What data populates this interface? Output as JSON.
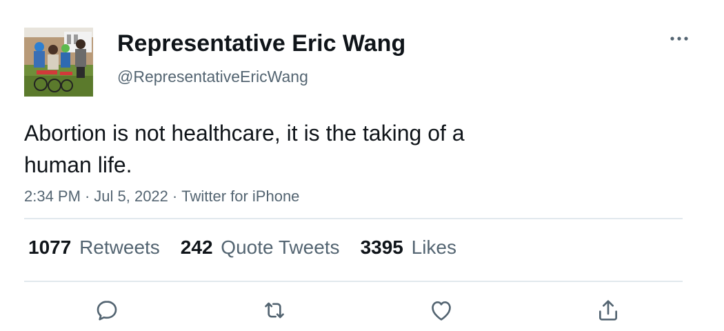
{
  "user": {
    "display_name": "Representative Eric Wang",
    "handle": "@RepresentativeEricWang"
  },
  "tweet": {
    "text": "Abortion is not healthcare, it is the taking of a human life.",
    "time": "2:34 PM",
    "date": "Jul 5, 2022",
    "source": "Twitter for iPhone",
    "separator": "·"
  },
  "stats": {
    "retweets_count": "1077",
    "retweets_label": "Retweets",
    "quotes_count": "242",
    "quotes_label": "Quote Tweets",
    "likes_count": "3395",
    "likes_label": "Likes"
  },
  "icons": {
    "more": "more-dots-icon",
    "reply": "reply-icon",
    "retweet": "retweet-icon",
    "like": "heart-icon",
    "share": "share-icon"
  },
  "colors": {
    "text_primary": "#0f1419",
    "text_secondary": "#536471",
    "divider": "#e1e8ed"
  }
}
